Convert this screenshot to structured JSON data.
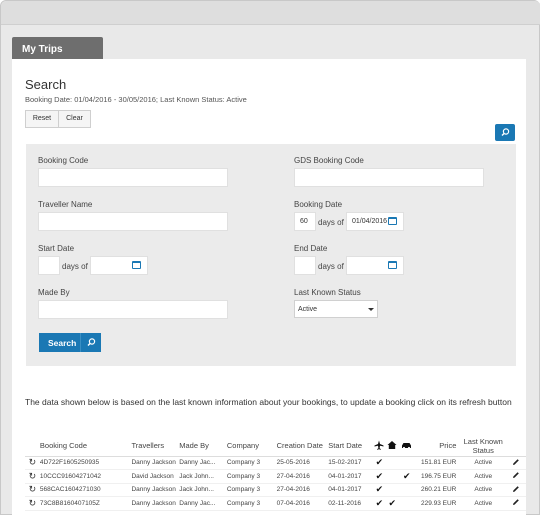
{
  "tab": {
    "label": "My Trips"
  },
  "search": {
    "title": "Search",
    "subtitle": "Booking Date: 01/04/2016 - 30/05/2016; Last Known Status: Active",
    "reset_label": "Reset",
    "clear_label": "Clear",
    "submit_label": "Search"
  },
  "form": {
    "booking_code": {
      "label": "Booking Code",
      "value": ""
    },
    "gds_booking_code": {
      "label": "GDS Booking Code",
      "value": ""
    },
    "traveller_name": {
      "label": "Traveller Name",
      "value": ""
    },
    "booking_date": {
      "label": "Booking Date",
      "days": "60",
      "days_label": "days of",
      "date": "01/04/2016"
    },
    "start_date": {
      "label": "Start Date",
      "days": "",
      "days_label": "days of",
      "date": ""
    },
    "end_date": {
      "label": "End Date",
      "days": "",
      "days_label": "days of",
      "date": ""
    },
    "made_by": {
      "label": "Made By",
      "value": ""
    },
    "last_known_status": {
      "label": "Last Known Status",
      "value": "Active"
    }
  },
  "info_text": "The data shown below is based on the last known information about your bookings, to update a booking click on its refresh button",
  "table": {
    "headers": [
      "Booking Code",
      "Travellers",
      "Made By",
      "Company",
      "Creation Date",
      "Start Date",
      "Price",
      "Last Known Status"
    ],
    "rows": [
      {
        "code": "4D722F1605250935",
        "travellers": "Danny Jackson",
        "made_by": "Danny Jac...",
        "company": "Company 3",
        "creation": "25-05-2016",
        "start": "15-02-2017",
        "flight": true,
        "hotel": false,
        "car": false,
        "price": "151.81 EUR",
        "status": "Active"
      },
      {
        "code": "10CCC91604271042",
        "travellers": "David Jackson",
        "made_by": "Jack John...",
        "company": "Company 3",
        "creation": "27-04-2016",
        "start": "04-01-2017",
        "flight": true,
        "hotel": false,
        "car": true,
        "price": "196.75 EUR",
        "status": "Active"
      },
      {
        "code": "568CAC1604271030",
        "travellers": "Danny Jackson",
        "made_by": "Jack John...",
        "company": "Company 3",
        "creation": "27-04-2016",
        "start": "04-01-2017",
        "flight": true,
        "hotel": false,
        "car": false,
        "price": "260.21 EUR",
        "status": "Active"
      },
      {
        "code": "73C8B8160407105Z",
        "travellers": "Danny Jackson",
        "made_by": "Danny Jac...",
        "company": "Company 3",
        "creation": "07-04-2016",
        "start": "02-11-2016",
        "flight": true,
        "hotel": true,
        "car": false,
        "price": "229.93 EUR",
        "status": "Active"
      }
    ]
  },
  "icons": {
    "search": "search-icon",
    "calendar": "calendar-icon",
    "refresh": "refresh-icon",
    "edit": "pencil-icon",
    "flight": "airplane-icon",
    "hotel": "house-icon",
    "car": "car-icon"
  },
  "colors": {
    "accent": "#1a78b4",
    "tab_bg": "#6e6e6e",
    "panel_bg": "#ebebeb"
  }
}
